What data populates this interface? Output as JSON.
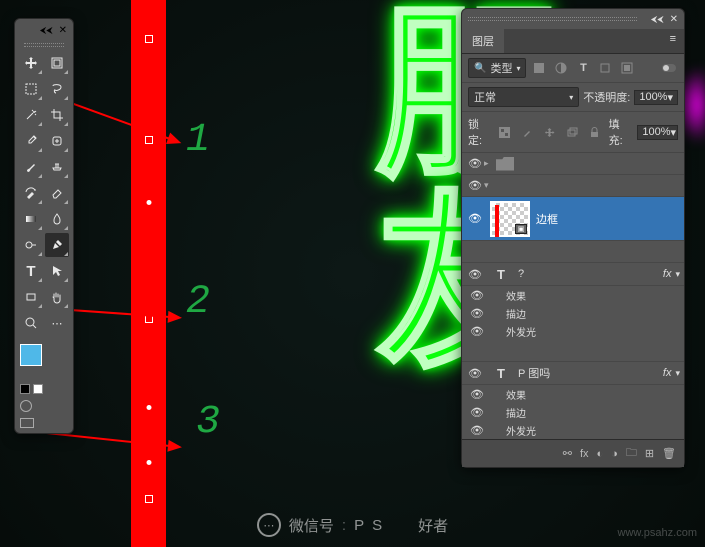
{
  "toolbox": {
    "tools": [
      "move-tool",
      "artboard-tool",
      "rect-marquee-tool",
      "lasso-tool",
      "magic-wand-tool",
      "crop-tool",
      "eyedropper-tool",
      "spot-heal-tool",
      "brush-tool",
      "clone-stamp-tool",
      "history-brush-tool",
      "eraser-tool",
      "gradient-tool",
      "blur-tool",
      "dodge-tool",
      "pen-tool",
      "type-tool",
      "path-select-tool",
      "rectangle-tool",
      "hand-tool",
      "zoom-tool",
      "edit-toolbar"
    ],
    "active": "pen-tool",
    "fg_color": "#4fb8e8",
    "bg_color": "#222222"
  },
  "layers_panel": {
    "tab": "图层",
    "filter_kind_label": "类型",
    "blend_mode": "正常",
    "opacity_label": "不透明度:",
    "opacity_value": "100%",
    "lock_label": "锁定:",
    "fill_label": "填充:",
    "fill_value": "100%",
    "layers": [
      {
        "name": "",
        "type": "group"
      },
      {
        "name": "边框",
        "type": "smart",
        "selected": true
      },
      {
        "name": "?",
        "type": "text",
        "fx": true,
        "effects": [
          "效果",
          "描边",
          "外发光"
        ]
      },
      {
        "name": "P 图吗",
        "type": "text",
        "fx": true,
        "effects": [
          "效果",
          "描边",
          "外发光"
        ]
      }
    ]
  },
  "annotations": {
    "n1": "1",
    "n2": "2",
    "n3": "3"
  },
  "watermark": {
    "left": "微信号",
    "right": "好者",
    "mid1": "P",
    "mid2": "S",
    "url": "www.psahz.com"
  }
}
